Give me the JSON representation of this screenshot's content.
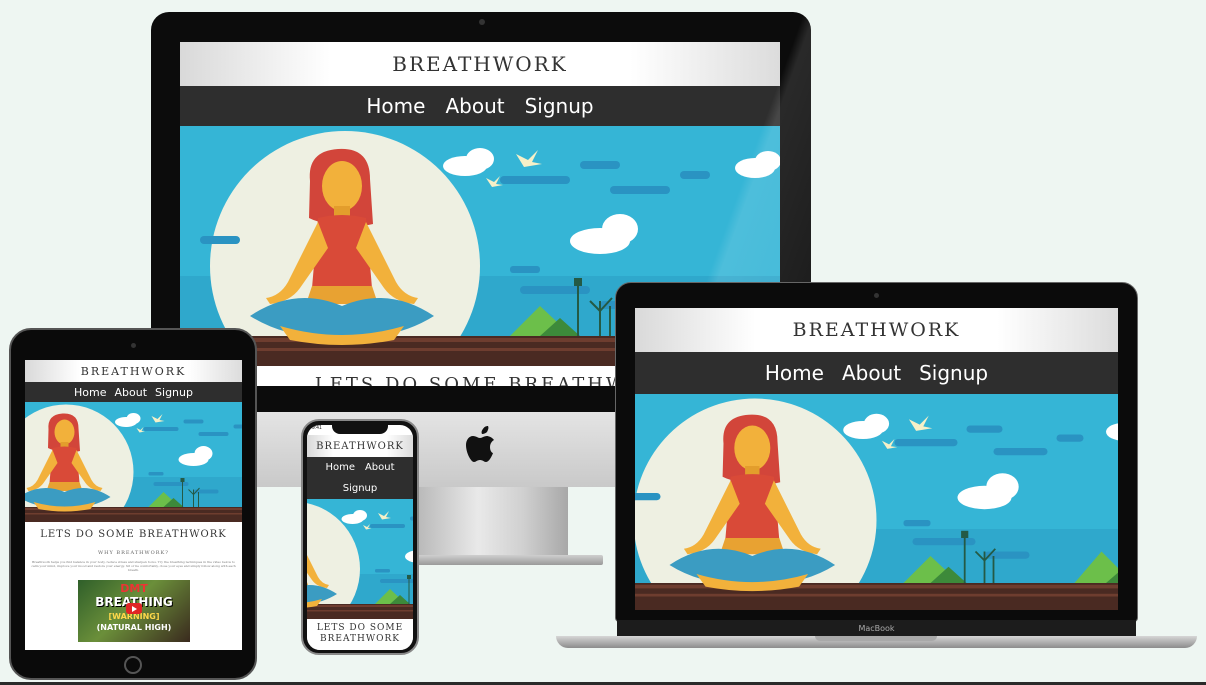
{
  "site": {
    "brand": "BREATHWORK",
    "nav": [
      "Home",
      "About",
      "Signup"
    ],
    "heading": "LETS DO SOME BREATHWORK",
    "subheading": "WHY BREATHWORK?",
    "paragraph": "Breathwork helps you find balance in your body, reduce stress and sharpen focus. Try the breathing techniques in the video below to calm your mind, improve your mood and restore your energy. Sit or lie comfortably, close your eyes and simply follow along with each breath."
  },
  "imac": {
    "partial_heading": "LETS DO SOME BREATHWO"
  },
  "macbook": {
    "label": "MacBook"
  },
  "iphone": {
    "time": "9:41",
    "heading_line1": "LETS DO SOME",
    "heading_line2": "BREATHWORK"
  },
  "video_thumbnail": {
    "line1": "DMT",
    "line2": "BREATHING",
    "line3": "[WARNING]",
    "line4": "(NATURAL HIGH)"
  },
  "colors": {
    "nav_bg": "#2e2e2e",
    "sky": "#35b5d6",
    "hair": "#d2453a",
    "top": "#d94a38",
    "skin": "#f2b13b",
    "pants": "#3b9cc2"
  }
}
